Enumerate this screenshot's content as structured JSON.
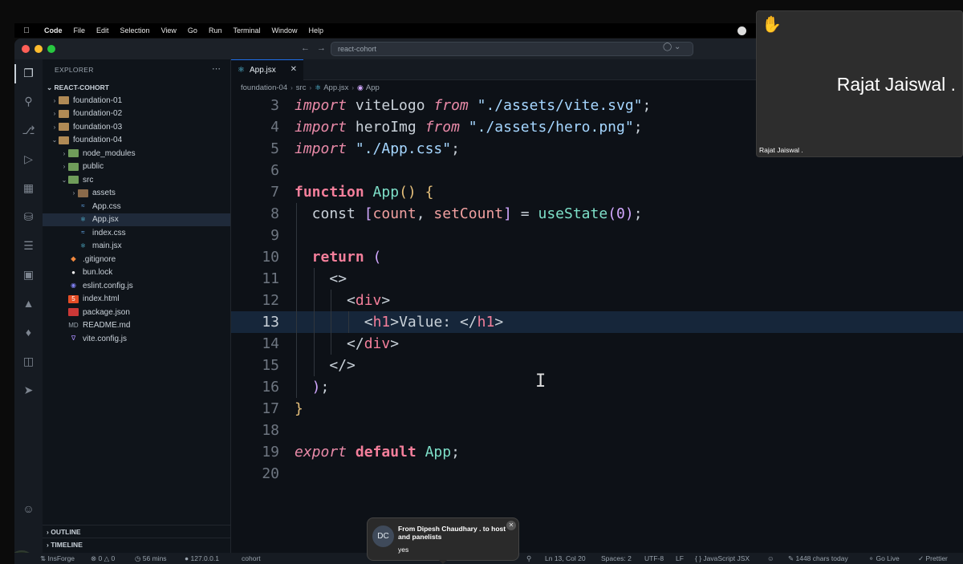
{
  "menubar": {
    "items": [
      "Code",
      "File",
      "Edit",
      "Selection",
      "View",
      "Go",
      "Run",
      "Terminal",
      "Window",
      "Help"
    ]
  },
  "titlebar": {
    "command_center": "react-cohort"
  },
  "sidebar": {
    "header": "EXPLORER",
    "root": "REACT-COHORT",
    "tree": [
      {
        "label": "foundation-01",
        "depth": 0,
        "type": "folder",
        "expanded": false
      },
      {
        "label": "foundation-02",
        "depth": 0,
        "type": "folder",
        "expanded": false
      },
      {
        "label": "foundation-03",
        "depth": 0,
        "type": "folder",
        "expanded": false
      },
      {
        "label": "foundation-04",
        "depth": 0,
        "type": "folder",
        "expanded": true
      },
      {
        "label": "node_modules",
        "depth": 1,
        "type": "folder-green",
        "expanded": false
      },
      {
        "label": "public",
        "depth": 1,
        "type": "folder-green",
        "expanded": false
      },
      {
        "label": "src",
        "depth": 1,
        "type": "folder-green",
        "expanded": true
      },
      {
        "label": "assets",
        "depth": 2,
        "type": "folder-brown",
        "expanded": false
      },
      {
        "label": "App.css",
        "depth": 2,
        "type": "css"
      },
      {
        "label": "App.jsx",
        "depth": 2,
        "type": "react",
        "selected": true
      },
      {
        "label": "index.css",
        "depth": 2,
        "type": "css"
      },
      {
        "label": "main.jsx",
        "depth": 2,
        "type": "react"
      },
      {
        "label": ".gitignore",
        "depth": 1,
        "type": "git"
      },
      {
        "label": "bun.lock",
        "depth": 1,
        "type": "bun"
      },
      {
        "label": "eslint.config.js",
        "depth": 1,
        "type": "eslint"
      },
      {
        "label": "index.html",
        "depth": 1,
        "type": "html"
      },
      {
        "label": "package.json",
        "depth": 1,
        "type": "json"
      },
      {
        "label": "README.md",
        "depth": 1,
        "type": "readme"
      },
      {
        "label": "vite.config.js",
        "depth": 1,
        "type": "vite"
      }
    ],
    "outline": "OUTLINE",
    "timeline": "TIMELINE"
  },
  "editor": {
    "tab_label": "App.jsx",
    "breadcrumb": [
      "foundation-04",
      "src",
      "App.jsx",
      "App"
    ],
    "current_line": 13,
    "lines": [
      {
        "n": "3",
        "indent": 0,
        "tokens": [
          [
            "kw-i",
            "import"
          ],
          [
            "id",
            " viteLogo "
          ],
          [
            "kw-i",
            "from"
          ],
          [
            "id",
            " "
          ],
          [
            "str",
            "\"./assets/vite.svg\""
          ],
          [
            "punc",
            ";"
          ]
        ]
      },
      {
        "n": "4",
        "indent": 0,
        "tokens": [
          [
            "kw-i",
            "import"
          ],
          [
            "id",
            " heroImg "
          ],
          [
            "kw-i",
            "from"
          ],
          [
            "id",
            " "
          ],
          [
            "str",
            "\"./assets/hero.png\""
          ],
          [
            "punc",
            ";"
          ]
        ]
      },
      {
        "n": "5",
        "indent": 0,
        "tokens": [
          [
            "kw-i",
            "import"
          ],
          [
            "id",
            " "
          ],
          [
            "str",
            "\"./App.css\""
          ],
          [
            "punc",
            ";"
          ]
        ]
      },
      {
        "n": "6",
        "indent": 0,
        "tokens": []
      },
      {
        "n": "7",
        "indent": 0,
        "tokens": [
          [
            "kw",
            "function"
          ],
          [
            "id",
            " "
          ],
          [
            "fn",
            "App"
          ],
          [
            "br",
            "()"
          ],
          [
            "id",
            " "
          ],
          [
            "br",
            "{"
          ]
        ]
      },
      {
        "n": "8",
        "indent": 1,
        "tokens": [
          [
            "kw-c",
            "const"
          ],
          [
            "id",
            " "
          ],
          [
            "num",
            "["
          ],
          [
            "var",
            "count"
          ],
          [
            "punc",
            ", "
          ],
          [
            "var",
            "setCount"
          ],
          [
            "num",
            "]"
          ],
          [
            "punc",
            " = "
          ],
          [
            "fn",
            "useState"
          ],
          [
            "num",
            "("
          ],
          [
            "num",
            "0"
          ],
          [
            "num",
            ")"
          ],
          [
            "punc",
            ";"
          ]
        ]
      },
      {
        "n": "9",
        "indent": 1,
        "tokens": []
      },
      {
        "n": "10",
        "indent": 1,
        "tokens": [
          [
            "kw",
            "return"
          ],
          [
            "id",
            " "
          ],
          [
            "num",
            "("
          ]
        ]
      },
      {
        "n": "11",
        "indent": 2,
        "tokens": [
          [
            "tagc",
            "<>"
          ]
        ]
      },
      {
        "n": "12",
        "indent": 3,
        "tokens": [
          [
            "tagc",
            "<"
          ],
          [
            "tagn",
            "div"
          ],
          [
            "tagc",
            ">"
          ]
        ]
      },
      {
        "n": "13",
        "indent": 4,
        "tokens": [
          [
            "tagc",
            "<"
          ],
          [
            "tagn",
            "h1"
          ],
          [
            "tagc",
            ">"
          ],
          [
            "id",
            "Value: "
          ],
          [
            "tagc",
            "</"
          ],
          [
            "tagn",
            "h1"
          ],
          [
            "tagc",
            ">"
          ]
        ]
      },
      {
        "n": "14",
        "indent": 3,
        "tokens": [
          [
            "tagc",
            "</"
          ],
          [
            "tagn",
            "div"
          ],
          [
            "tagc",
            ">"
          ]
        ]
      },
      {
        "n": "15",
        "indent": 2,
        "tokens": [
          [
            "tagc",
            "</>"
          ]
        ]
      },
      {
        "n": "16",
        "indent": 1,
        "tokens": [
          [
            "num",
            ")"
          ],
          [
            "punc",
            ";"
          ]
        ]
      },
      {
        "n": "17",
        "indent": 0,
        "tokens": [
          [
            "br",
            "}"
          ]
        ]
      },
      {
        "n": "18",
        "indent": 0,
        "tokens": []
      },
      {
        "n": "19",
        "indent": 0,
        "tokens": [
          [
            "kw-i",
            "export"
          ],
          [
            "id",
            " "
          ],
          [
            "kw",
            "default"
          ],
          [
            "id",
            " "
          ],
          [
            "fn",
            "App"
          ],
          [
            "punc",
            ";"
          ]
        ]
      },
      {
        "n": "20",
        "indent": 0,
        "tokens": []
      }
    ]
  },
  "statusbar": {
    "remote": "InsForge",
    "errors": "0",
    "warnings": "0",
    "time": "56 mins",
    "host": "127.0.0.1",
    "branch": "cohort",
    "position": "Ln 13, Col 20",
    "spaces": "Spaces: 2",
    "encoding": "UTF-8",
    "eol": "LF",
    "language": "JavaScript JSX",
    "chars": "1448 chars today",
    "golive": "Go Live",
    "prettier": "Prettier"
  },
  "video": {
    "name_large": "Rajat Jaiswal .",
    "name_label": "Rajat Jaiswal ."
  },
  "toast": {
    "initials": "DC",
    "from": "From Dipesh Chaudhary . to host and panelists",
    "message": "yes"
  },
  "colors": {
    "accent": "#1f6feb",
    "keyword": "#f47f9b",
    "string": "#a5d6ff",
    "function": "#7ee0c9"
  }
}
